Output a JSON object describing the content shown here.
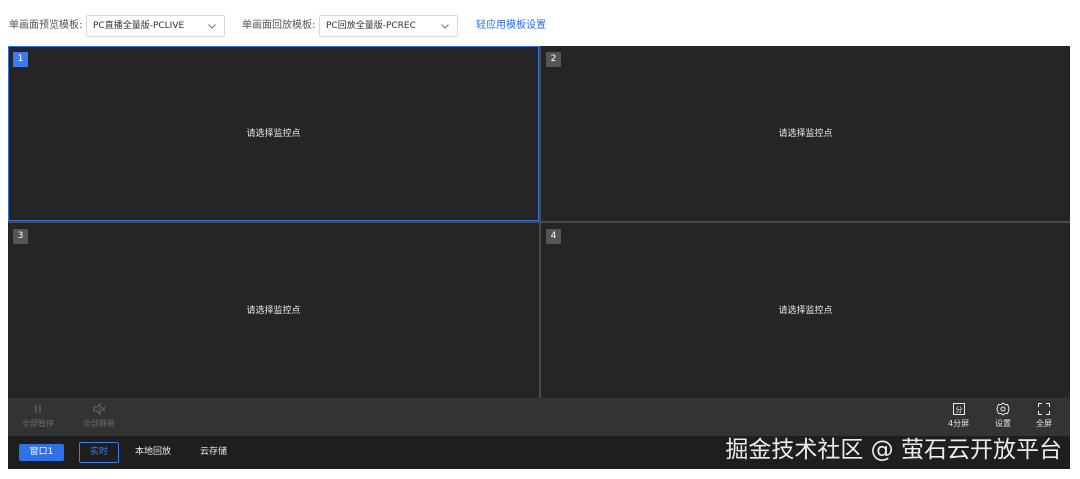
{
  "toolbar": {
    "preview_label": "单画面预览模板:",
    "preview_value": "PC直播全量版-PCLIVE",
    "playback_label": "单画面回放模板:",
    "playback_value": "PC回放全量版-PCREC",
    "settings_link": "轻应用模板设置"
  },
  "panes": [
    {
      "num": "1",
      "message": "请选择监控点",
      "active": true
    },
    {
      "num": "2",
      "message": "请选择监控点",
      "active": false
    },
    {
      "num": "3",
      "message": "请选择监控点",
      "active": false
    },
    {
      "num": "4",
      "message": "请选择监控点",
      "active": false
    }
  ],
  "controls": {
    "pause_all": "全部暂停",
    "mute_all": "全部静音",
    "split": "4分屏",
    "settings": "设置",
    "fullscreen": "全屏"
  },
  "bottom": {
    "window_btn": "窗口1",
    "realtime": "实时",
    "local_playback": "本地回放",
    "cloud_storage": "云存储",
    "watermark": "掘金技术社区 @ 萤石云开放平台"
  },
  "colors": {
    "accent": "#2f72e8",
    "pane_bg": "#252525",
    "control_bg": "#333333",
    "bottom_bg": "#1e1e1e",
    "link": "#2a6fdb"
  }
}
